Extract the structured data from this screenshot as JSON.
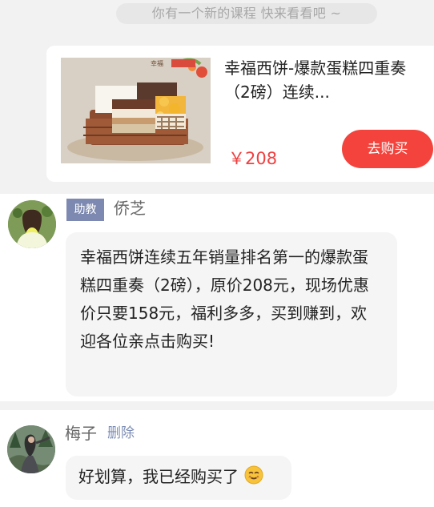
{
  "notice": {
    "text": "你有一个新的课程 快来看看吧 ~"
  },
  "product": {
    "title": "幸福西饼-爆款蛋糕四重奏（2磅）连续...",
    "price": "￥208",
    "buy_button_label": "去购买",
    "thumbnail_icon": "cake-product-image"
  },
  "messages": [
    {
      "role_badge": "助教",
      "sender": "侨芝",
      "text": "幸福西饼连续五年销量排名第一的爆款蛋糕四重奏（2磅），原价208元，现场优惠价只要158元，福利多多，买到赚到，欢迎各位亲点击购买!",
      "avatar_icon": "woman-avatar"
    },
    {
      "sender": "梅子",
      "delete_label": "删除",
      "text": "好划算，我已经购买了",
      "emoji_icon": "smile-icon",
      "avatar_icon": "forest-avatar"
    }
  ],
  "colors": {
    "accent_red": "#f3433c",
    "price_red": "#f03f3f",
    "badge_blue": "#7d89b0",
    "link_blue": "#7d8db4"
  }
}
